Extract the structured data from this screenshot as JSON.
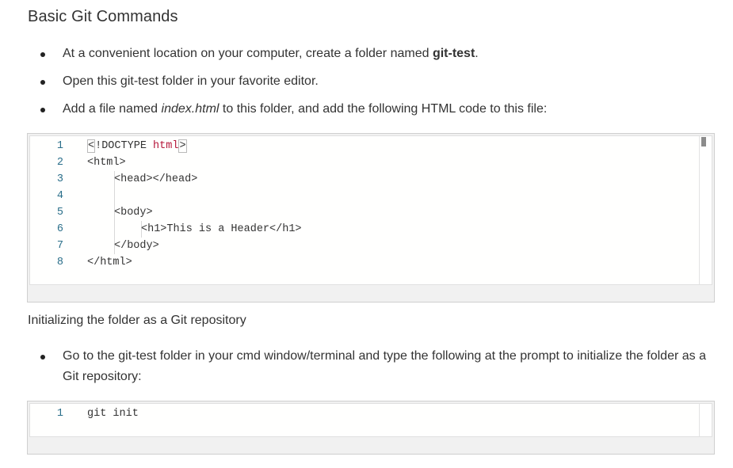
{
  "section": {
    "title": "Basic Git Commands",
    "bullets1": [
      {
        "pre": "At a convenient location on your computer, create a folder named ",
        "bold": "git-test",
        "post": "."
      },
      {
        "text": "Open this git-test folder in your favorite editor."
      },
      {
        "pre": "Add a file named ",
        "italic": "index.html",
        "post": " to this folder, and add the following HTML code to this file:"
      }
    ],
    "subheading": "Initializing the folder as a Git repository",
    "bullets2": [
      {
        "text": "Go to the git-test folder in your cmd window/terminal and type the following at the prompt to initialize the folder as a Git repository:"
      }
    ]
  },
  "code1": {
    "line_numbers": [
      "1",
      "2",
      "3",
      "4",
      "5",
      "6",
      "7",
      "8"
    ],
    "lines": {
      "l1_lt": "<",
      "l1_doctype": "!DOCTYPE ",
      "l1_html": "html",
      "l1_gt": ">",
      "l2": "<html>",
      "l3": "<head></head>",
      "l4": "",
      "l5": "<body>",
      "l6": "<h1>This is a Header</h1>",
      "l7": "</body>",
      "l8": "</html>"
    }
  },
  "code2": {
    "line_numbers": [
      "1"
    ],
    "lines": {
      "l1": "git init"
    }
  }
}
